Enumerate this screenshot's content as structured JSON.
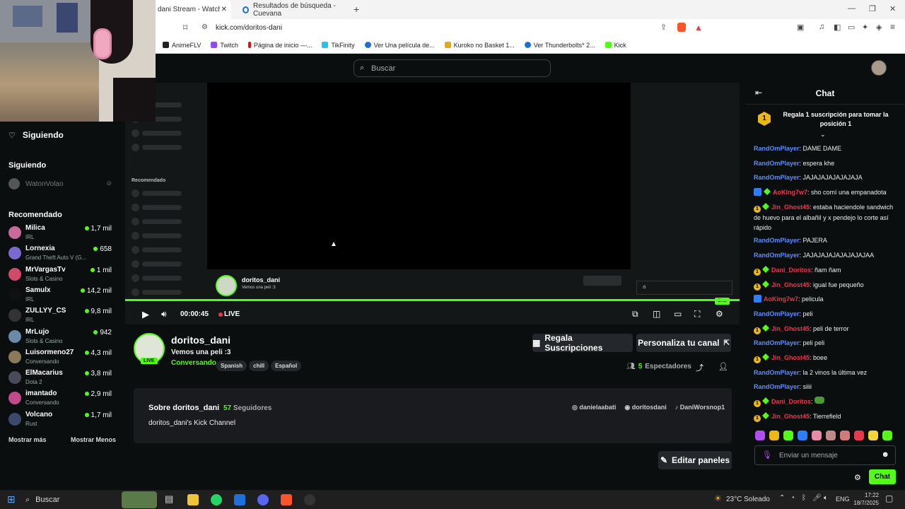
{
  "browser": {
    "tabs": [
      {
        "label": "dani Stream - Watch Live"
      },
      {
        "label": "Resultados de búsqueda - Cuevana"
      }
    ],
    "url": "kick.com/doritos-dani",
    "bookmarks": [
      {
        "label": "AnimeFLV",
        "color": "#222"
      },
      {
        "label": "Twitch",
        "color": "#9146ff"
      },
      {
        "label": "Página de inicio —...",
        "color": "#e50914"
      },
      {
        "label": "TikFinity",
        "color": "#25c2f4"
      },
      {
        "label": "Ver Una película de...",
        "color": "#1f6fd1"
      },
      {
        "label": "Kuroko no Basket 1...",
        "color": "#e6a817"
      },
      {
        "label": "Ver Thunderbolts* 2...",
        "color": "#1f6fd1"
      },
      {
        "label": "Kick",
        "color": "#53fc18"
      }
    ]
  },
  "header": {
    "search_placeholder": "Buscar"
  },
  "sidebar": {
    "following_title": "Siguiendo",
    "following_section": "Siguiendo",
    "following_offline": "WatonVolao",
    "recommended_title": "Recomendado",
    "show_more": "Mostrar más",
    "show_less": "Mostrar Menos",
    "streamers": [
      {
        "name": "Milica",
        "category": "IRL",
        "viewers": "1,7 mil",
        "color": "#c86a9a"
      },
      {
        "name": "Lornexia",
        "category": "Grand Theft Auto V (G...",
        "viewers": "658",
        "color": "#7a6ad0"
      },
      {
        "name": "MrVargasTv",
        "category": "Slots & Casino",
        "viewers": "1 mil",
        "color": "#d04a6a"
      },
      {
        "name": "Samulx",
        "category": "IRL",
        "viewers": "14,2 mil",
        "color": "#111"
      },
      {
        "name": "ZULLYY_CS",
        "category": "IRL",
        "viewers": "9,8 mil",
        "color": "#333"
      },
      {
        "name": "MrLujo",
        "category": "Slots & Casino",
        "viewers": "942",
        "color": "#6a8aa8"
      },
      {
        "name": "Luisormeno27",
        "category": "Conversando",
        "viewers": "4,3 mil",
        "color": "#8a7a5a"
      },
      {
        "name": "ElMacarius",
        "category": "Dota 2",
        "viewers": "3,8 mil",
        "color": "#4a4a5a"
      },
      {
        "name": "imantado",
        "category": "Conversando",
        "viewers": "2,9 mil",
        "color": "#c04a8a"
      },
      {
        "name": "Volcano",
        "category": "Rust",
        "viewers": "1,7 mil",
        "color": "#3a4a6a"
      }
    ]
  },
  "player": {
    "time": "00:00:45",
    "live_label": "LIVE",
    "inner_streamer": "doritos_dani",
    "inner_title": "Vemos una peli :3",
    "inner_sidebar_label": "Recomendado",
    "inner_chat_input": "a",
    "inner_chat_button": "Chat"
  },
  "stream": {
    "name": "doritos_dani",
    "title": "Vemos una peli :3",
    "category": "Conversando",
    "tags": [
      "Spanish",
      "chill",
      "Español"
    ],
    "live_badge": "LIVE",
    "gift_button": "Regala Suscripciones",
    "customize_button": "Personaliza tu canal",
    "viewers_count": "5",
    "viewers_label": "Espectadores"
  },
  "about": {
    "title": "Sobre doritos_dani",
    "followers_count": "57",
    "followers_label": "Seguidores",
    "description": "doritos_dani's Kick Channel",
    "socials": [
      "danielaabati",
      "doritosdani",
      "DaniWorsnop1"
    ],
    "edit_panels": "Editar paneles"
  },
  "chat": {
    "title": "Chat",
    "pinned_rank": "1",
    "pinned_text": "Regala 1 suscripción para tomar la posición 1",
    "input_placeholder": "Enviar un mensaje",
    "send_button": "Chat",
    "messages": [
      {
        "user": "RandOmPlayer",
        "text": "DAME DAME",
        "style": "blue",
        "badges": ""
      },
      {
        "user": "RandOmPlayer",
        "text": "espera khe",
        "style": "blue",
        "badges": ""
      },
      {
        "user": "RandOmPlayer",
        "text": "JAJAJAJAJAJAJAJA",
        "style": "blue",
        "badges": ""
      },
      {
        "user": "AoKing7w7",
        "text": "sho comí una empanadota",
        "style": "red",
        "badges": "b3g"
      },
      {
        "user": "Jin_Ghost45",
        "text": "estaba haciendole sandwich de huevo para el albañil y x pendejo lo corte así rápido",
        "style": "red",
        "badges": "1g"
      },
      {
        "user": "RandOmPlayer",
        "text": "PAJERA",
        "style": "blue",
        "badges": ""
      },
      {
        "user": "RandOmPlayer",
        "text": "JAJAJAJAJAJAJAJAJAA",
        "style": "blue",
        "badges": ""
      },
      {
        "user": "Dani_Doritos",
        "text": "ñam ñam",
        "style": "red",
        "badges": "1g"
      },
      {
        "user": "Jin_Ghost45",
        "text": "igual fue pequeño",
        "style": "red",
        "badges": "1g"
      },
      {
        "user": "AoKing7w7",
        "text": "pelicula",
        "style": "red",
        "badges": "b3"
      },
      {
        "user": "RandOmPlayer",
        "text": "peli",
        "style": "blue",
        "badges": ""
      },
      {
        "user": "Jin_Ghost45",
        "text": "peli de terror",
        "style": "red",
        "badges": "1g"
      },
      {
        "user": "RandOmPlayer",
        "text": "peli peli",
        "style": "blue",
        "badges": ""
      },
      {
        "user": "Jin_Ghost45",
        "text": "boee",
        "style": "red",
        "badges": "1g"
      },
      {
        "user": "RandOmPlayer",
        "text": "la 2 vinos la última vez",
        "style": "blue",
        "badges": ""
      },
      {
        "user": "RandOmPlayer",
        "text": "siiii",
        "style": "blue",
        "badges": ""
      },
      {
        "user": "Dani_Doritos",
        "text": "",
        "style": "red",
        "badges": "1g"
      },
      {
        "user": "Jin_Ghost45",
        "text": "Tierrefield",
        "style": "red",
        "badges": "1g"
      }
    ]
  },
  "taskbar": {
    "search": "Buscar",
    "weather": "23°C Soleado",
    "lang": "ENG",
    "time": "17:22",
    "date": "18/7/2025"
  }
}
